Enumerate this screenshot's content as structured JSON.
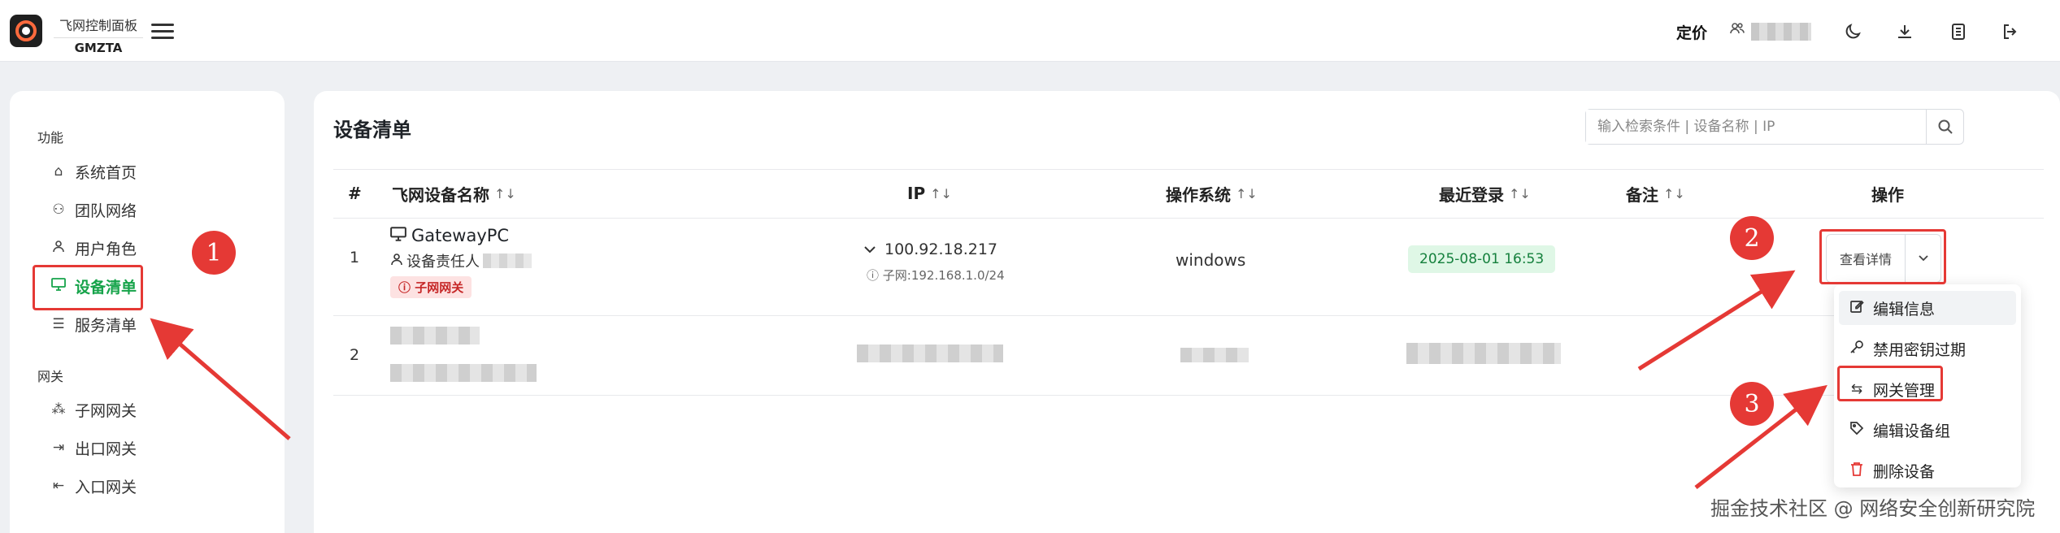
{
  "header": {
    "brand_line1": "飞网控制面板",
    "brand_line2": "GMZTA",
    "pricing": "定价"
  },
  "sidebar": {
    "sections": [
      {
        "title": "功能",
        "items": [
          {
            "label": "系统首页",
            "icon": "home-icon"
          },
          {
            "label": "团队网络",
            "icon": "network-icon"
          },
          {
            "label": "用户角色",
            "icon": "user-icon"
          },
          {
            "label": "设备清单",
            "icon": "monitor-icon",
            "active": true
          },
          {
            "label": "服务清单",
            "icon": "database-icon"
          }
        ]
      },
      {
        "title": "网关",
        "items": [
          {
            "label": "子网网关",
            "icon": "subnet-icon"
          },
          {
            "label": "出口网关",
            "icon": "exit-icon"
          },
          {
            "label": "入口网关",
            "icon": "entry-icon"
          }
        ]
      }
    ]
  },
  "main": {
    "title": "设备清单",
    "search_placeholder": "输入检索条件 | 设备名称 | IP",
    "columns": [
      "#",
      "飞网设备名称",
      "IP",
      "操作系统",
      "最近登录",
      "备注",
      "操作"
    ],
    "sort_glyph": "↑↓",
    "rows": [
      {
        "index": "1",
        "name": "GatewayPC",
        "owner_label": "设备责任人",
        "tag": "子网网关",
        "ip": "100.92.18.217",
        "subnet": "子网:192.168.1.0/24",
        "os": "windows",
        "last_login": "2025-08-01 16:53"
      },
      {
        "index": "2"
      }
    ],
    "action_label": "查看详情",
    "dropdown": [
      {
        "label": "编辑信息",
        "icon": "edit-icon"
      },
      {
        "label": "禁用密钥过期",
        "icon": "key-icon"
      },
      {
        "label": "网关管理",
        "icon": "swap-icon"
      },
      {
        "label": "编辑设备组",
        "icon": "tag-icon"
      },
      {
        "label": "删除设备",
        "icon": "trash-icon"
      }
    ]
  },
  "annotations": [
    "1",
    "2",
    "3"
  ],
  "watermark": "掘金技术社区 @ 网络安全创新研究院",
  "colors": {
    "accent": "#16a34a",
    "danger": "#e53935"
  }
}
